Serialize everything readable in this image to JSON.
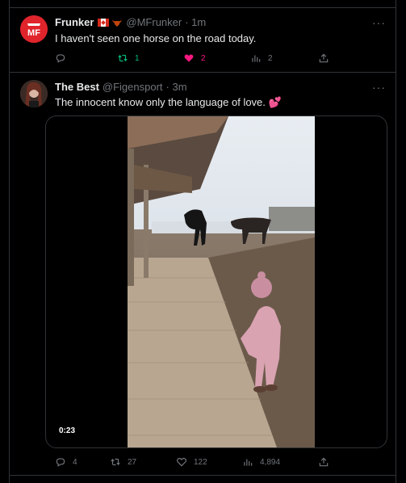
{
  "tweets": [
    {
      "name": "Frunker",
      "handle": "@MFrunker",
      "time": "· 1m",
      "text": "I haven't seen one horse on the road today.",
      "actions": {
        "replies": "",
        "retweets": "1",
        "likes": "2",
        "views": "2"
      },
      "avatar_text": "MF"
    },
    {
      "name": "The Best",
      "handle": "@Figensport",
      "time": "· 3m",
      "text": "The innocent know only the language of love. 💕",
      "video": {
        "duration": "0:23"
      },
      "actions": {
        "replies": "4",
        "retweets": "27",
        "likes": "122",
        "views": "4,894"
      }
    }
  ],
  "colors": {
    "background": "#000000",
    "text": "#e7e9ea",
    "muted": "#71767b",
    "retweet": "#00ba7c",
    "like": "#f91880",
    "border": "#2f3336"
  },
  "icons": [
    "more-icon",
    "reply-icon",
    "retweet-icon",
    "like-icon",
    "views-icon",
    "share-icon"
  ]
}
